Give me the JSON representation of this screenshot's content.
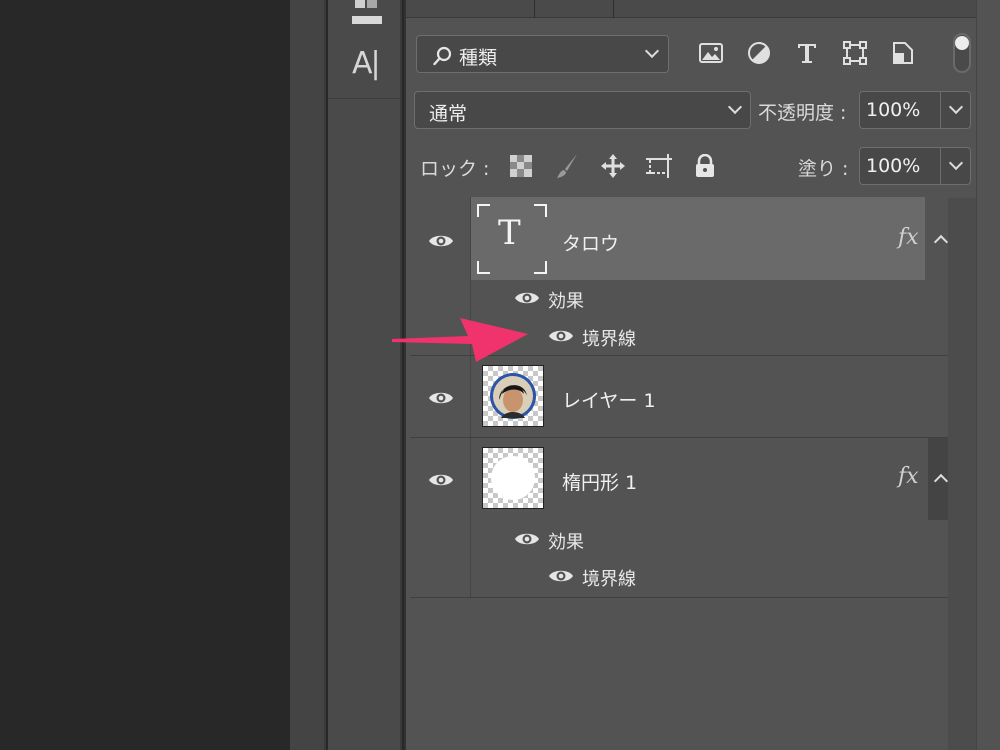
{
  "toolbar": {
    "text_tool_label": "A|"
  },
  "filters": {
    "search_icon": "search-icon",
    "kind_label": "種類",
    "filter_icons": [
      "image-filter-icon",
      "adjustment-filter-icon",
      "type-filter-icon",
      "shape-filter-icon",
      "smart-object-filter-icon"
    ]
  },
  "blend": {
    "mode": "通常",
    "opacity_label": "不透明度 :",
    "opacity_value": "100%"
  },
  "lock": {
    "label": "ロック :",
    "icons": [
      "lock-transparent-pixels-icon",
      "lock-image-pixels-icon",
      "lock-position-icon",
      "lock-artboard-icon",
      "lock-all-icon"
    ],
    "fill_label": "塗り :",
    "fill_value": "100%"
  },
  "layers": [
    {
      "name": "タロウ",
      "type": "text",
      "thumb_glyph": "T",
      "has_fx": true,
      "fx_label": "fx",
      "effects_label": "効果",
      "effects": [
        "境界線"
      ]
    },
    {
      "name": "レイヤー 1",
      "type": "image",
      "has_fx": false
    },
    {
      "name": "楕円形 1",
      "type": "shape",
      "has_fx": true,
      "fx_label": "fx",
      "effects_label": "効果",
      "effects": [
        "境界線"
      ]
    }
  ],
  "colors": {
    "panel_bg": "#535353",
    "selected_row": "#6a6a6a",
    "arrow": "#f0336c",
    "face_ring": "#2a55a8"
  }
}
